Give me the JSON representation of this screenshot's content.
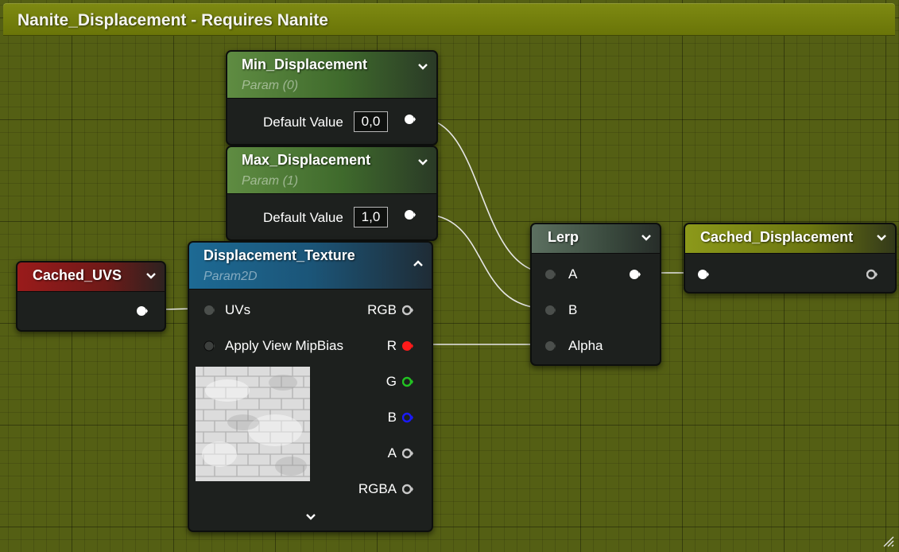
{
  "graph": {
    "title": "Nanite_Displacement - Requires Nanite"
  },
  "nodes": {
    "min_displacement": {
      "title": "Min_Displacement",
      "subtitle": "Param (0)",
      "default_label": "Default Value",
      "default_value": "0,0"
    },
    "max_displacement": {
      "title": "Max_Displacement",
      "subtitle": "Param (1)",
      "default_label": "Default Value",
      "default_value": "1,0"
    },
    "cached_uvs": {
      "title": "Cached_UVS"
    },
    "displacement_texture": {
      "title": "Displacement_Texture",
      "subtitle": "Param2D",
      "inputs": [
        "UVs",
        "Apply View MipBias"
      ],
      "outputs": [
        "RGB",
        "R",
        "G",
        "B",
        "A",
        "RGBA"
      ]
    },
    "lerp": {
      "title": "Lerp",
      "inputs": [
        "A",
        "B",
        "Alpha"
      ]
    },
    "cached_displacement": {
      "title": "Cached_Displacement"
    }
  },
  "colors": {
    "background": "#545f14",
    "title_bar": "#7a8610",
    "pin_white": "#ffffff",
    "pin_red": "#ff1a1a",
    "pin_green": "#22c322",
    "pin_blue": "#1a1aff",
    "pin_gray": "#c8c8c8"
  },
  "icons": {
    "collapse": "chevron-down-icon",
    "expand": "chevron-up-icon",
    "resize": "resize-grip-icon"
  }
}
